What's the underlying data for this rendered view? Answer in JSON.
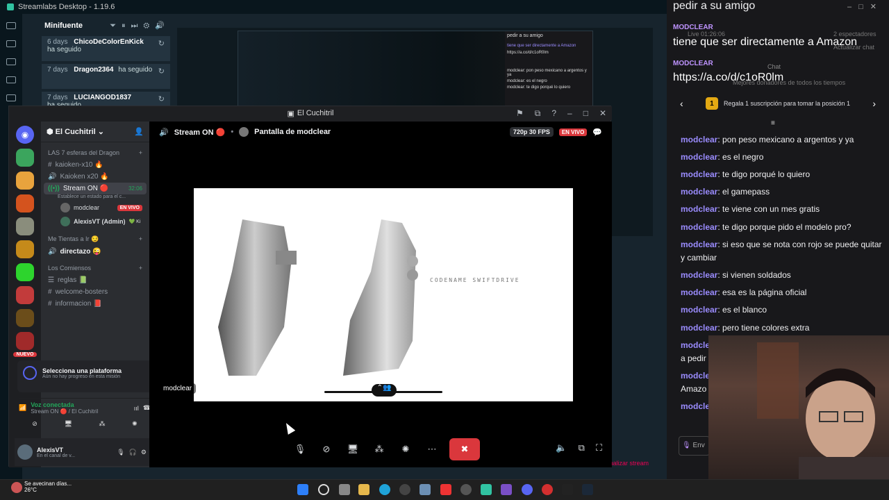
{
  "streamlabs": {
    "title": "Streamlabs Desktop - 1.19.6",
    "activity_title": "Minifuente",
    "events": [
      {
        "days": "6 days",
        "name": "ChicoDeColorEnKick",
        "action": "ha seguido"
      },
      {
        "days": "7 days",
        "name": "Dragon2364",
        "action": "ha seguido"
      },
      {
        "days": "7 days",
        "name": "LUCIANGOD1837",
        "action": "ha seguido"
      }
    ],
    "nested": {
      "chat_line1": "pedir a su amigo",
      "chat_line2": "tiene que ser directamente a Amazon",
      "chat_line3": "https://a.co/d/c1oR0lm",
      "msgs": [
        "modclear: pon peso mexicano a argentos y ya",
        "modclear: es el negro",
        "modclear: te digo porqué lo quiero"
      ]
    },
    "stream_button": "Finalizar stream"
  },
  "discord": {
    "window_title": "El Cuchitril",
    "server_name": "El Cuchitril",
    "categories": [
      {
        "label": "LAS 7 esferas del Dragon",
        "channels": [
          {
            "type": "text",
            "label": "kaioken-x10 🔥"
          },
          {
            "type": "voice",
            "label": "Kaioken x20 🔥"
          },
          {
            "type": "stage",
            "label": "Stream ON 🔴",
            "time": "32:06",
            "status": "Establece un estado para el c..."
          }
        ]
      },
      {
        "label": "Me Tientas a Ir 😏",
        "channels": [
          {
            "type": "voice",
            "label": "directazo 😜"
          }
        ]
      },
      {
        "label": "Los Comiensos",
        "channels": [
          {
            "type": "text",
            "label": "reglas 📗"
          },
          {
            "type": "text",
            "label": "welcome-bosters"
          },
          {
            "type": "text",
            "label": "informacion 📕"
          }
        ]
      }
    ],
    "voice_users": [
      {
        "name": "modclear",
        "badge": "EN VIVO"
      },
      {
        "name": "AlexisVT (Admin)",
        "badge": "💚 Ki"
      }
    ],
    "platform_card": {
      "title": "Selecciona una plataforma",
      "subtitle": "Aún no hay progreso en esta misión"
    },
    "voice_connected": {
      "title": "Voz conectada",
      "subtitle": "Stream ON 🔴 / El Cuchitril"
    },
    "user": {
      "name": "AlexisVT",
      "status": "En el canal de v..."
    },
    "topbar": {
      "channel": "Stream ON 🔴",
      "screen": "Pantalla de modclear",
      "quality": "720p 30 FPS",
      "live": "EN VIVO"
    },
    "stream": {
      "label": "modclear",
      "codename": "CODENAME SWIFTDRIVE"
    },
    "nuevo_badge": "NUEVO"
  },
  "twitch": {
    "top_msg": "pedir a su amigo",
    "live_info": "Live 01:26:06",
    "viewers": "2 espectadores",
    "tab_label": "Chat",
    "refresh_label": "Actualizar chat",
    "msg2_user": "MODCLEAR",
    "msg2_text": "tiene que ser directamente a Amazon",
    "msg3_user": "MODCLEAR",
    "msg3_text": "https://a.co/d/c1oR0lm",
    "top_donors": "Mejores donadores de todos los tiempos",
    "banner_text": "Regala 1 suscripción para tomar la posición 1",
    "messages": [
      {
        "user": "modclear",
        "text": "pon peso mexicano a argentos y ya"
      },
      {
        "user": "modclear",
        "text": "es el negro"
      },
      {
        "user": "modclear",
        "text": "te digo porqué lo quiero"
      },
      {
        "user": "modclear",
        "text": "el gamepass"
      },
      {
        "user": "modclear",
        "text": "te viene con un mes gratis"
      },
      {
        "user": "modclear",
        "text": "te digo porque pido el modelo pro?"
      },
      {
        "user": "modclear",
        "text": "si eso que se nota con rojo se puede quitar y cambiar"
      },
      {
        "user": "modclear",
        "text": "si vienen soldados"
      },
      {
        "user": "modclear",
        "text": "esa es la página oficial"
      },
      {
        "user": "modclear",
        "text": "es el blanco"
      },
      {
        "user": "modclear",
        "text": "pero tiene colores extra"
      }
    ],
    "partial": [
      "modcle",
      "a pedir",
      "modcle",
      "Amazo",
      "modcle"
    ],
    "input_placeholder": "Env"
  },
  "taskbar": {
    "weather_text": "Se avecinan días...",
    "weather_temp": "26°C"
  }
}
